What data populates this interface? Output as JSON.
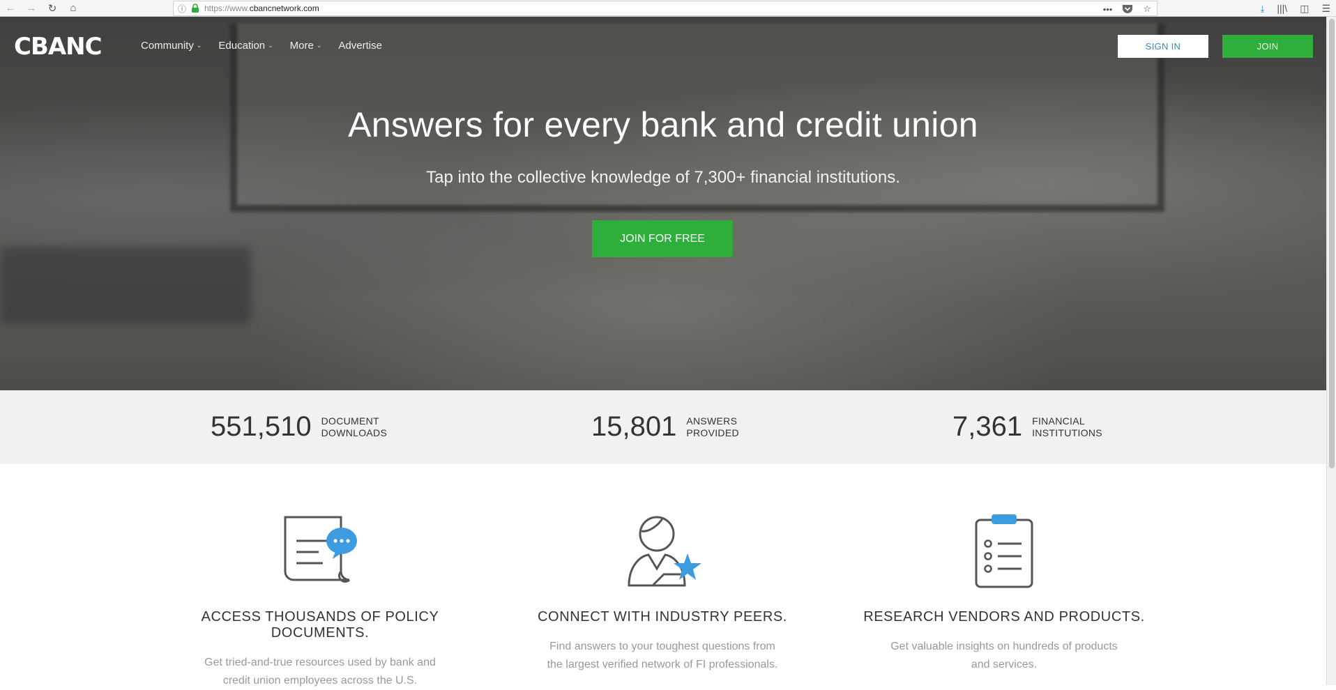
{
  "browser": {
    "url_prefix": "https://www.",
    "url_domain": "cbancnetwork.com",
    "menu_dots": "•••"
  },
  "site": {
    "logo": "CBANC",
    "nav": [
      {
        "label": "Community"
      },
      {
        "label": "Education"
      },
      {
        "label": "More"
      },
      {
        "label": "Advertise"
      }
    ],
    "signin_label": "SIGN IN",
    "join_label": "JOIN"
  },
  "hero": {
    "title": "Answers for every bank and credit union",
    "subtitle": "Tap into the collective knowledge of 7,300+ financial institutions.",
    "cta": "JOIN FOR FREE"
  },
  "stats": [
    {
      "value": "551,510",
      "line1": "DOCUMENT",
      "line2": "DOWNLOADS"
    },
    {
      "value": "15,801",
      "line1": "ANSWERS",
      "line2": "PROVIDED"
    },
    {
      "value": "7,361",
      "line1": "FINANCIAL",
      "line2": "INSTITUTIONS"
    }
  ],
  "features": [
    {
      "title": "ACCESS THOUSANDS OF POLICY DOCUMENTS.",
      "line1": "Get tried-and-true resources used by bank and",
      "line2": "credit union employees across the U.S.",
      "icon": "document-chat-icon"
    },
    {
      "title": "CONNECT WITH INDUSTRY PEERS.",
      "line1": "Find answers to your toughest questions from",
      "line2": "the largest verified network of FI professionals.",
      "icon": "person-star-icon"
    },
    {
      "title": "RESEARCH VENDORS AND PRODUCTS.",
      "line1": "Get valuable insights on hundreds of products",
      "line2": "and services.",
      "icon": "clipboard-list-icon"
    }
  ],
  "colors": {
    "accent_green": "#2eae3a",
    "accent_blue": "#3d9be0",
    "link_blue": "#2a8ccf"
  }
}
